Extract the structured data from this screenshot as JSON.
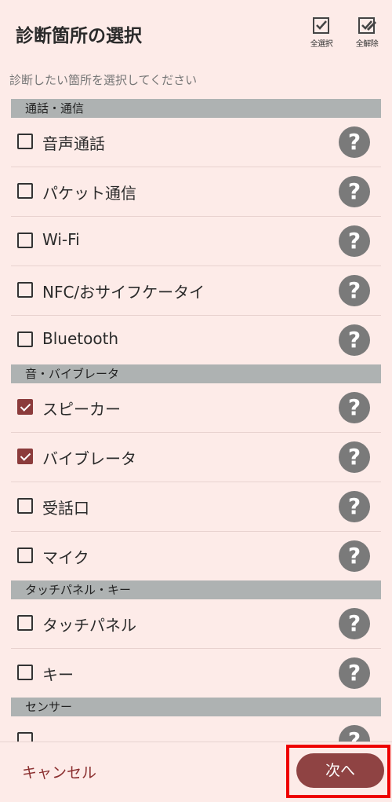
{
  "header": {
    "title": "診断箇所の選択",
    "select_all_label": "全選択",
    "deselect_all_label": "全解除"
  },
  "subtitle": "診断したい箇所を選択してください",
  "sections": [
    {
      "title": "通話・通信",
      "items": [
        {
          "label": "音声通話",
          "checked": false
        },
        {
          "label": "パケット通信",
          "checked": false
        },
        {
          "label": "Wi-Fi",
          "checked": false
        },
        {
          "label": "NFC/おサイフケータイ",
          "checked": false
        },
        {
          "label": "Bluetooth",
          "checked": false
        }
      ]
    },
    {
      "title": "音・バイブレータ",
      "items": [
        {
          "label": "スピーカー",
          "checked": true
        },
        {
          "label": "バイブレータ",
          "checked": true
        },
        {
          "label": "受話口",
          "checked": false
        },
        {
          "label": "マイク",
          "checked": false
        }
      ]
    },
    {
      "title": "タッチパネル・キー",
      "items": [
        {
          "label": "タッチパネル",
          "checked": false
        },
        {
          "label": "キー",
          "checked": false
        }
      ]
    },
    {
      "title": "センサー",
      "items": []
    }
  ],
  "help_symbol": "?",
  "footer": {
    "cancel_label": "キャンセル",
    "next_label": "次へ"
  },
  "colors": {
    "background": "#fdebe8",
    "section_bar": "#aeb2b2",
    "accent": "#8f4343",
    "highlight_box": "#ee0000"
  }
}
